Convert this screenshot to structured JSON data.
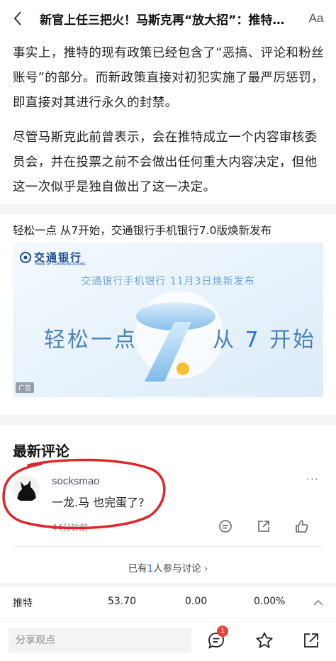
{
  "header": {
    "title": "新官上任三把火！马斯克再“放大招”：推特将永久封禁模仿他人账号",
    "font_button": "Aa"
  },
  "article": {
    "paragraphs": [
      "事实上，推特的现有政策已经包含了“恶搞、评论和粉丝账号”的部分。而新政策直接对初犯实施了最严厉惩罚，即直接对其进行永久的封禁。",
      "尽管马斯克此前曾表示，会在推特成立一个内容审核委员会，并在投票之前不会做出任何重大内容决定，但他这一次似乎是独自做出了这一决定。"
    ]
  },
  "ad": {
    "title": "轻松一点 从7开始，交通银行手机银行7.0版焕新发布",
    "logo_name": "交通银行",
    "logo_sub": "BANK OF COMMUNICATIONS",
    "headline": "交通银行手机银行 11月3日焕新发布",
    "slogan_left": "轻松一点",
    "slogan_right_pre": "从",
    "slogan_right_num": "7",
    "slogan_right_post": "开始",
    "tag": "广告"
  },
  "comments": {
    "section_title": "最新评论",
    "items": [
      {
        "user": "socksmao",
        "text": "一龙.马 也完蛋了?",
        "time": "44分钟前"
      }
    ],
    "more_icon": "more-icon",
    "discussion_pre": "已有",
    "discussion_num": "1",
    "discussion_post": "人参与讨论",
    "discussion_arrow": "›"
  },
  "stock": {
    "name": "推特",
    "price": "53.70",
    "change": "0.00",
    "pct": "0.00%"
  },
  "bottom_bar": {
    "placeholder": "分享观点",
    "comment_badge": "1"
  },
  "colors": {
    "accent": "#2e6fd6",
    "badge": "#e8433a",
    "annotation_red": "#e0262a"
  }
}
